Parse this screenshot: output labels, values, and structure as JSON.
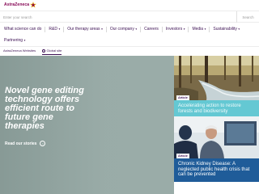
{
  "logo": {
    "text": "AstraZeneca"
  },
  "search": {
    "placeholder": "Enter your search",
    "button_label": "Search"
  },
  "nav": {
    "row1": [
      {
        "label": "What science can do",
        "dropdown": false
      },
      {
        "label": "R&D",
        "dropdown": true
      },
      {
        "label": "Our therapy areas",
        "dropdown": true
      },
      {
        "label": "Our company",
        "dropdown": true
      },
      {
        "label": "Careers",
        "dropdown": false
      },
      {
        "label": "Investors",
        "dropdown": true
      },
      {
        "label": "Media",
        "dropdown": true
      },
      {
        "label": "Sustainability",
        "dropdown": true
      }
    ],
    "row2": [
      {
        "label": "Partnering",
        "dropdown": true
      }
    ]
  },
  "subbar": {
    "websites_label": "AstraZeneca Websites",
    "global_label": "Global site"
  },
  "hero": {
    "title": "Novel gene editing technology offers efficient route to future gene therapies",
    "cta_label": "Read our stories"
  },
  "cards": [
    {
      "badge": "Article",
      "title": "Accelerating action to restore forests and biodiversity"
    },
    {
      "badge": "Article",
      "title": "Chronic Kidney Disease: A neglected public health crisis that can be prevented"
    }
  ],
  "colors": {
    "brand": "#830051",
    "text_primary": "#3c1053",
    "card1_panel": "#64c8d3",
    "card2_panel": "#1f5c99",
    "hero_bg": "#9aaca8"
  }
}
